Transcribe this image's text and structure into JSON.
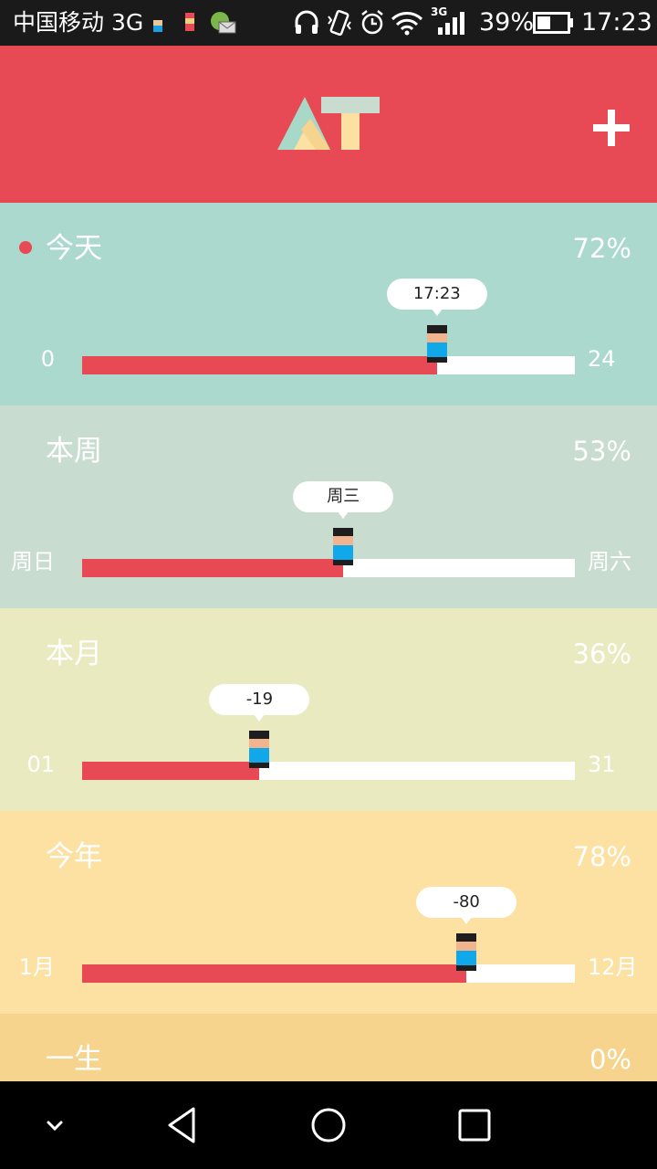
{
  "status_bar": {
    "carrier": "中国移动 3G",
    "network_tag": "3G",
    "battery": "39%",
    "time": "17:23"
  },
  "header": {
    "logo_text": "AT",
    "add_icon": "plus-icon"
  },
  "colors": {
    "accent": "#e84a55",
    "today_bg": "#abd9cd",
    "week_bg": "#c8dccf",
    "month_bg": "#e9eac0",
    "year_bg": "#fce1a3",
    "life_bg": "#f6d48e"
  },
  "sections": [
    {
      "title": "今天",
      "percent": "72%",
      "progress": 0.72,
      "left_label": "0",
      "right_label": "24",
      "bubble": "17:23",
      "current": true
    },
    {
      "title": "本周",
      "percent": "53%",
      "progress": 0.53,
      "left_label": "周日",
      "right_label": "周六",
      "bubble": "周三"
    },
    {
      "title": "本月",
      "percent": "36%",
      "progress": 0.36,
      "left_label": "01",
      "right_label": "31",
      "bubble": "-19"
    },
    {
      "title": "今年",
      "percent": "78%",
      "progress": 0.78,
      "left_label": "1月",
      "right_label": "12月",
      "bubble": "-80"
    },
    {
      "title": "一生",
      "percent": "0%"
    }
  ],
  "nav_bar": {
    "items": [
      "chevron-down-icon",
      "back-icon",
      "home-icon",
      "recents-icon"
    ]
  }
}
